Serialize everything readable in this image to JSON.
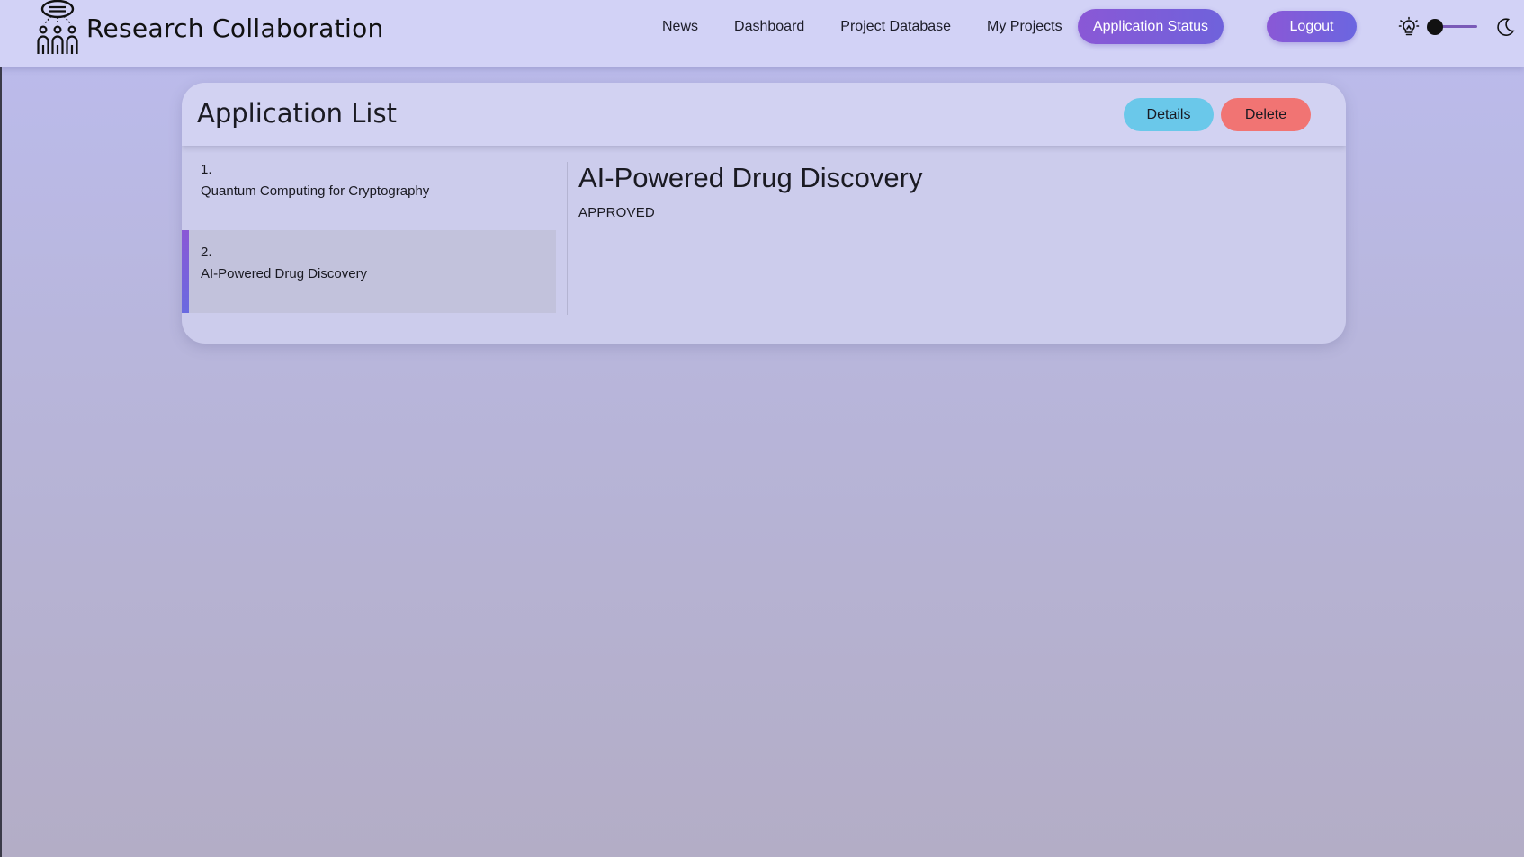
{
  "app": {
    "title": "Research Collaboration",
    "logo_icon": "team-chat-icon"
  },
  "nav": {
    "links": [
      {
        "label": "News"
      },
      {
        "label": "Dashboard"
      },
      {
        "label": "Project Database"
      },
      {
        "label": "My Projects"
      }
    ],
    "active_label": "Application Status",
    "logout_label": "Logout",
    "theme": {
      "light_icon": "lightbulb-icon",
      "dark_icon": "moon-icon",
      "mode": "light"
    }
  },
  "application_list": {
    "title": "Application List",
    "details_label": "Details",
    "delete_label": "Delete",
    "items": [
      {
        "number": "1.",
        "title": "Quantum Computing for Cryptography",
        "selected": false
      },
      {
        "number": "2.",
        "title": "AI-Powered Drug Discovery",
        "selected": true
      }
    ],
    "selected": {
      "title": "AI-Powered Drug Discovery",
      "status": "APPROVED"
    }
  },
  "colors": {
    "accent_gradient_start": "#8a58d6",
    "accent_gradient_end": "#6a6ae0",
    "details_button": "#6ac8ea",
    "delete_button": "#f17473"
  }
}
